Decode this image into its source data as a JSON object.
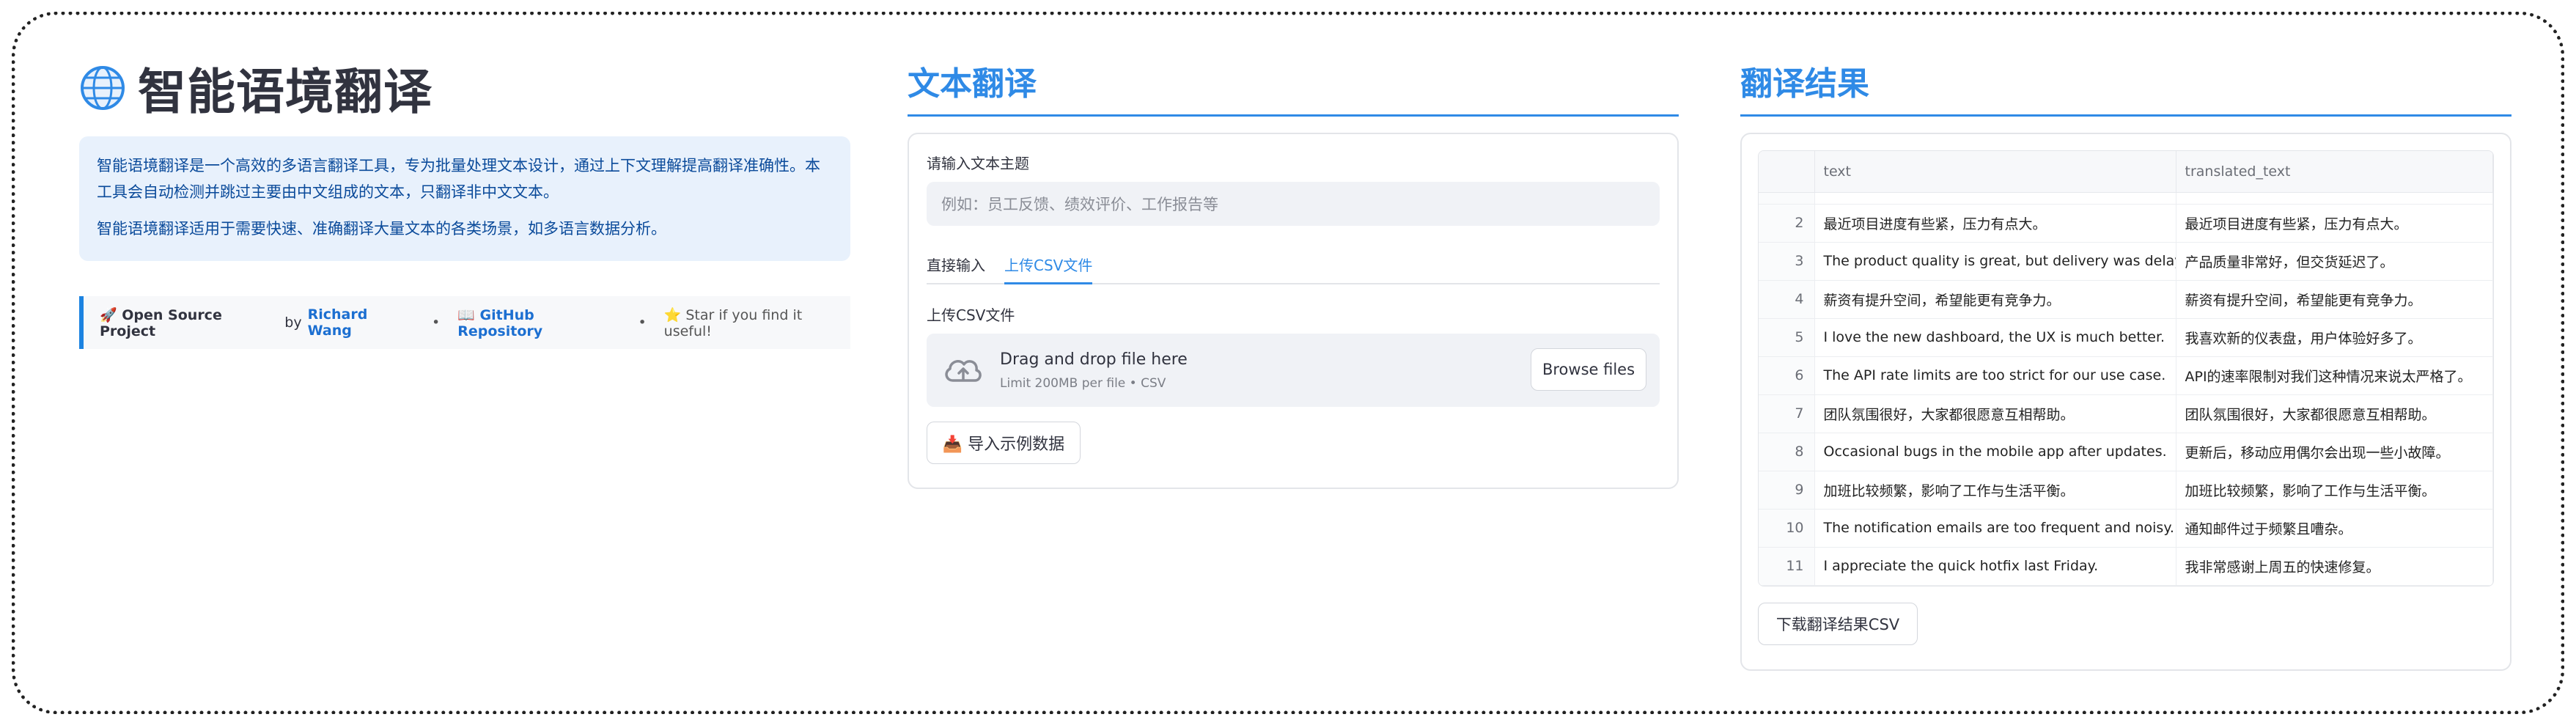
{
  "app": {
    "title": "智能语境翻译",
    "description_1": "智能语境翻译是一个高效的多语言翻译工具，专为批量处理文本设计，通过上下文理解提高翻译准确性。本工具会自动检测并跳过主要由中文组成的文本，只翻译非中文文本。",
    "description_2": "智能语境翻译适用于需要快速、准确翻译大量文本的各类场景，如多语言数据分析。"
  },
  "oss": {
    "prefix": "🚀 Open Source Project",
    "by": "by",
    "author": "Richard Wang",
    "repo": "📖 GitHub Repository",
    "star": "⭐ Star if you find it useful!",
    "sep": "•"
  },
  "translate_panel": {
    "title": "文本翻译",
    "topic_label": "请输入文本主题",
    "topic_placeholder": "例如：员工反馈、绩效评价、工作报告等",
    "tabs": [
      "直接输入",
      "上传CSV文件"
    ],
    "active_tab": 1,
    "upload_label": "上传CSV文件",
    "dropzone_main": "Drag and drop file here",
    "dropzone_sub": "Limit 200MB per file • CSV",
    "browse_label": "Browse files",
    "sample_label": "📥 导入示例数据"
  },
  "results_panel": {
    "title": "翻译结果",
    "columns": [
      "",
      "text",
      "translated_text"
    ],
    "rows": [
      [
        "2",
        "最近项目进度有些紧，压力有点大。",
        "最近项目进度有些紧，压力有点大。"
      ],
      [
        "3",
        "The product quality is great, but delivery was delayed.",
        "产品质量非常好，但交货延迟了。"
      ],
      [
        "4",
        "薪资有提升空间，希望能更有竞争力。",
        "薪资有提升空间，希望能更有竞争力。"
      ],
      [
        "5",
        "I love the new dashboard, the UX is much better.",
        "我喜欢新的仪表盘，用户体验好多了。"
      ],
      [
        "6",
        "The API rate limits are too strict for our use case.",
        "API的速率限制对我们这种情况来说太严格了。"
      ],
      [
        "7",
        "团队氛围很好，大家都很愿意互相帮助。",
        "团队氛围很好，大家都很愿意互相帮助。"
      ],
      [
        "8",
        "Occasional bugs in the mobile app after updates.",
        "更新后，移动应用偶尔会出现一些小故障。"
      ],
      [
        "9",
        "加班比较频繁，影响了工作与生活平衡。",
        "加班比较频繁，影响了工作与生活平衡。"
      ],
      [
        "10",
        "The notification emails are too frequent and noisy.",
        "通知邮件过于频繁且嘈杂。"
      ],
      [
        "11",
        "I appreciate the quick hotfix last Friday.",
        "我非常感谢上周五的快速修复。"
      ]
    ],
    "download_label": "下载翻译结果CSV"
  },
  "colors": {
    "accent": "#2f8ae6",
    "info_bg": "#e8f1fc",
    "info_text": "#0a4a9a"
  }
}
